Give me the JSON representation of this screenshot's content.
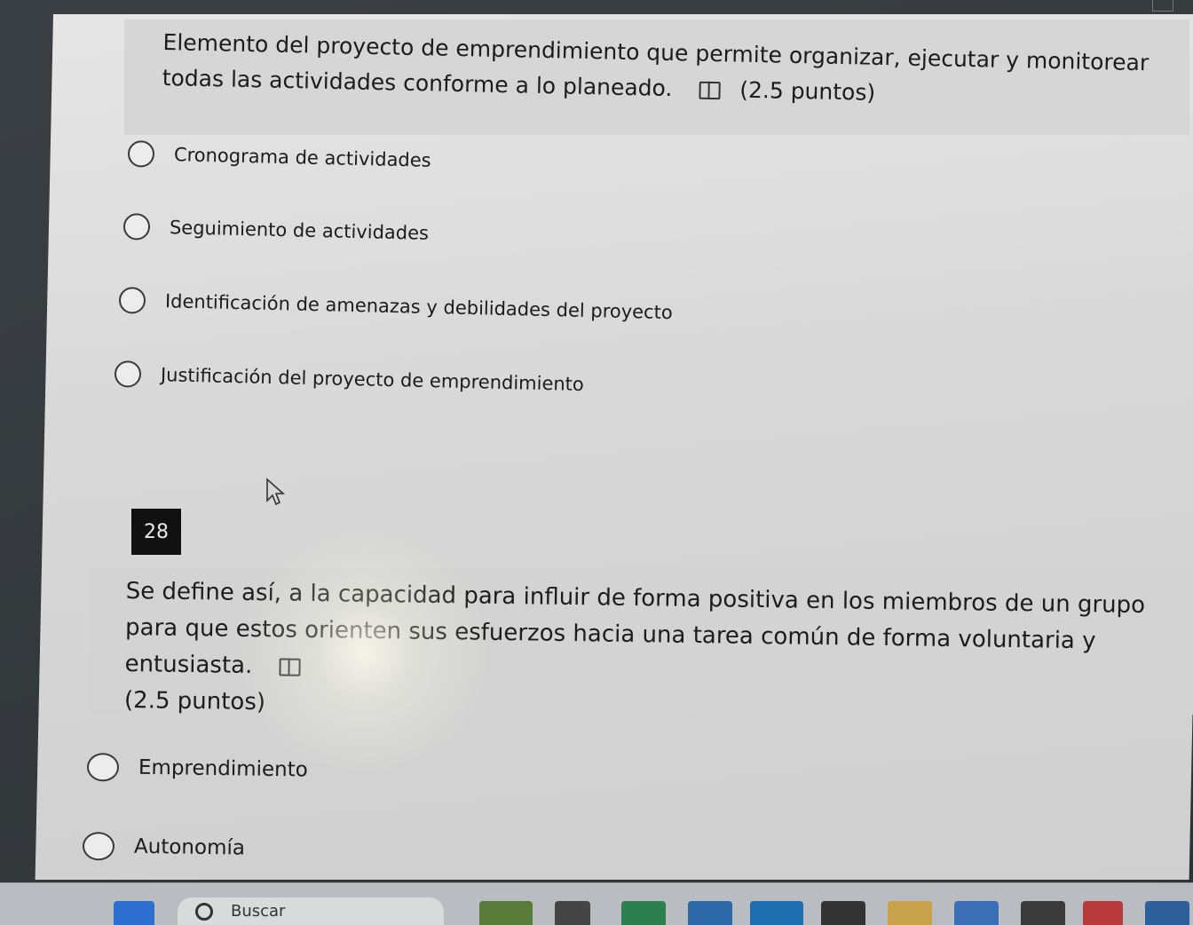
{
  "question_27": {
    "text": "Elemento del proyecto de emprendimiento que permite organizar, ejecutar y monitorear todas las actividades conforme a lo planeado.",
    "points": "(2.5 puntos)",
    "options": [
      "Cronograma de actividades",
      "Seguimiento de actividades",
      "Identificación de amenazas y debilidades del proyecto",
      "Justificación del proyecto de emprendimiento"
    ]
  },
  "question_28": {
    "number": "28",
    "text": "Se define así, a la capacidad para influir de forma positiva en los miembros de un grupo para que estos orienten sus esfuerzos hacia una tarea común de forma voluntaria y entusiasta.",
    "points": "(2.5 puntos)",
    "options": [
      "Emprendimiento",
      "Autonomía"
    ]
  },
  "taskbar": {
    "search_label": "Buscar"
  },
  "icons": {
    "immersive_reader": "immersive-reader-icon",
    "cursor": "mouse-pointer-icon",
    "search": "search-icon"
  }
}
